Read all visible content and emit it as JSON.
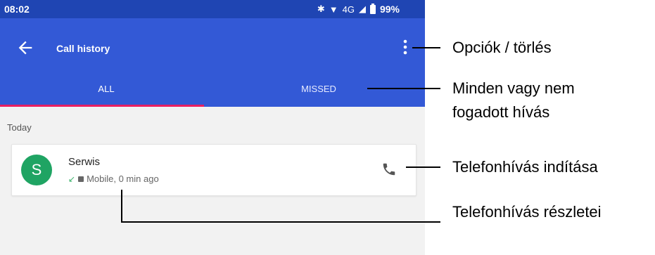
{
  "status_bar": {
    "time": "08:02",
    "network_text": "4G",
    "battery": "99%"
  },
  "toolbar": {
    "title": "Call history"
  },
  "tabs": [
    {
      "label": "ALL",
      "selected": true
    },
    {
      "label": "MISSED",
      "selected": false
    }
  ],
  "section": {
    "header": "Today"
  },
  "call_log": [
    {
      "avatar_letter": "S",
      "name": "Serwis",
      "detail": "Mobile, 0 min ago",
      "direction_icon": "incoming-call-arrow-icon"
    }
  ],
  "annotations": {
    "options": "Opciók / törlés",
    "tabs_line1": "Minden vagy nem",
    "tabs_line2": "fogadott hívás",
    "start_call": "Telefonhívás indítása",
    "call_details": "Telefonhívás részletei"
  },
  "colors": {
    "status_bar": "#1f45b3",
    "toolbar": "#3359d6",
    "tab_indicator": "#e91e63",
    "avatar": "#1fa463",
    "incoming_arrow": "#3bb36b"
  }
}
